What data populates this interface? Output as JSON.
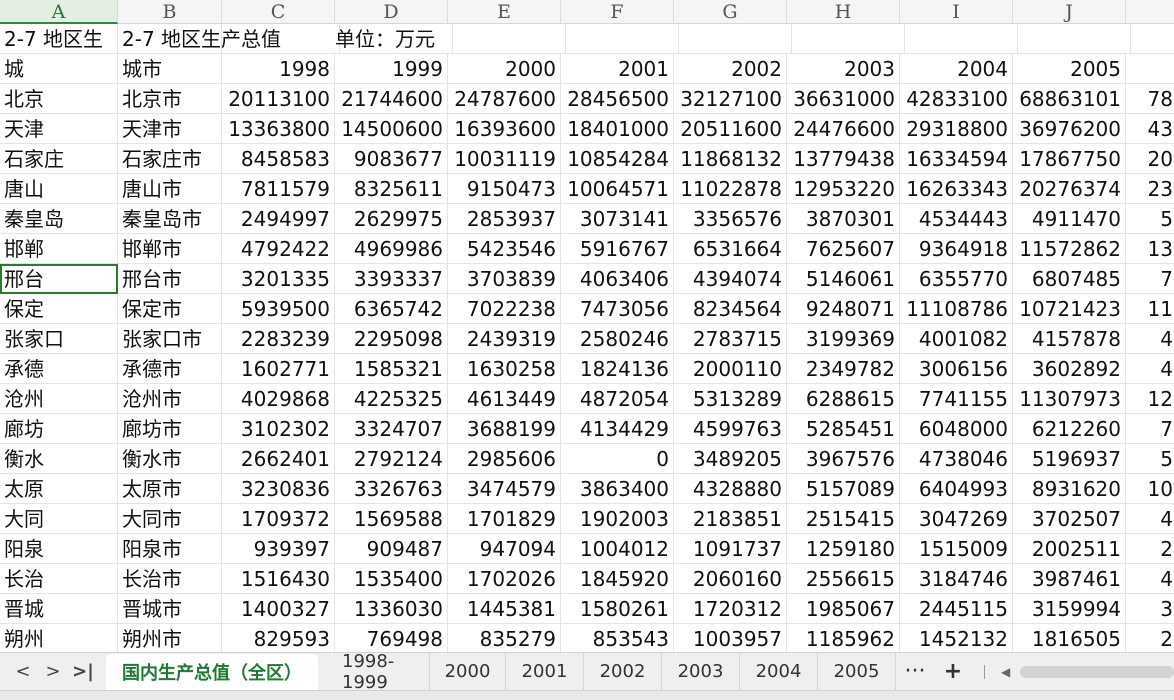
{
  "columns": [
    "A",
    "B",
    "C",
    "D",
    "E",
    "F",
    "G",
    "H",
    "I",
    "J",
    ""
  ],
  "title_row": {
    "a": "2-7 地区生",
    "b": "2-7 地区生产总值",
    "c": "单位：万元"
  },
  "header_row": [
    "城",
    "城市",
    "1998",
    "1999",
    "2000",
    "2001",
    "2002",
    "2003",
    "2004",
    "2005",
    ""
  ],
  "rows": [
    [
      "北京",
      "北京市",
      "20113100",
      "21744600",
      "24787600",
      "28456500",
      "32127100",
      "36631000",
      "42833100",
      "68863101",
      "78"
    ],
    [
      "天津",
      "天津市",
      "13363800",
      "14500600",
      "16393600",
      "18401000",
      "20511600",
      "24476600",
      "29318800",
      "36976200",
      "43"
    ],
    [
      "石家庄",
      "石家庄市",
      "8458583",
      "9083677",
      "10031119",
      "10854284",
      "11868132",
      "13779438",
      "16334594",
      "17867750",
      "20"
    ],
    [
      "唐山",
      "唐山市",
      "7811579",
      "8325611",
      "9150473",
      "10064571",
      "11022878",
      "12953220",
      "16263343",
      "20276374",
      "23"
    ],
    [
      "秦皇岛",
      "秦皇岛市",
      "2494997",
      "2629975",
      "2853937",
      "3073141",
      "3356576",
      "3870301",
      "4534443",
      "4911470",
      "5"
    ],
    [
      "邯郸",
      "邯郸市",
      "4792422",
      "4969986",
      "5423546",
      "5916767",
      "6531664",
      "7625607",
      "9364918",
      "11572862",
      "13"
    ],
    [
      "邢台",
      "邢台市",
      "3201335",
      "3393337",
      "3703839",
      "4063406",
      "4394074",
      "5146061",
      "6355770",
      "6807485",
      "7"
    ],
    [
      "保定",
      "保定市",
      "5939500",
      "6365742",
      "7022238",
      "7473056",
      "8234564",
      "9248071",
      "11108786",
      "10721423",
      "11"
    ],
    [
      "张家口",
      "张家口市",
      "2283239",
      "2295098",
      "2439319",
      "2580246",
      "2783715",
      "3199369",
      "4001082",
      "4157878",
      "4"
    ],
    [
      "承德",
      "承德市",
      "1602771",
      "1585321",
      "1630258",
      "1824136",
      "2000110",
      "2349782",
      "3006156",
      "3602892",
      "4"
    ],
    [
      "沧州",
      "沧州市",
      "4029868",
      "4225325",
      "4613449",
      "4872054",
      "5313289",
      "6288615",
      "7741155",
      "11307973",
      "12"
    ],
    [
      "廊坊",
      "廊坊市",
      "3102302",
      "3324707",
      "3688199",
      "4134429",
      "4599763",
      "5285451",
      "6048000",
      "6212260",
      "7"
    ],
    [
      "衡水",
      "衡水市",
      "2662401",
      "2792124",
      "2985606",
      "0",
      "3489205",
      "3967576",
      "4738046",
      "5196937",
      "5"
    ],
    [
      "太原",
      "太原市",
      "3230836",
      "3326763",
      "3474579",
      "3863400",
      "4328880",
      "5157089",
      "6404993",
      "8931620",
      "10"
    ],
    [
      "大同",
      "大同市",
      "1709372",
      "1569588",
      "1701829",
      "1902003",
      "2183851",
      "2515415",
      "3047269",
      "3702507",
      "4"
    ],
    [
      "阳泉",
      "阳泉市",
      "939397",
      "909487",
      "947094",
      "1004012",
      "1091737",
      "1259180",
      "1515009",
      "2002511",
      "2"
    ],
    [
      "长治",
      "长治市",
      "1516430",
      "1535400",
      "1702026",
      "1845920",
      "2060160",
      "2556615",
      "3184746",
      "3987461",
      "4"
    ],
    [
      "晋城",
      "晋城市",
      "1400327",
      "1336030",
      "1445381",
      "1580261",
      "1720312",
      "1985067",
      "2445115",
      "3159994",
      "3"
    ],
    [
      "朔州",
      "朔州市",
      "829593",
      "769498",
      "835279",
      "853543",
      "1003957",
      "1185962",
      "1452132",
      "1816505",
      "2"
    ]
  ],
  "selected_row_index": 6,
  "tabs": {
    "active": "国内生产总值（全区）",
    "others": [
      "1998-1999",
      "2000",
      "2001",
      "2002",
      "2003",
      "2004",
      "2005"
    ]
  },
  "nav": {
    "prev": "<",
    "next": ">",
    "last": ">|",
    "more": "···",
    "add": "+"
  },
  "icons": {
    "prev": "chevron-left-icon",
    "next": "chevron-right-icon",
    "last": "last-sheet-icon",
    "more": "more-icon",
    "add": "plus-icon",
    "scroll_left": "scroll-left-icon"
  },
  "colors": {
    "accent": "#1e7b2f",
    "selection": "#2b7a2b"
  }
}
